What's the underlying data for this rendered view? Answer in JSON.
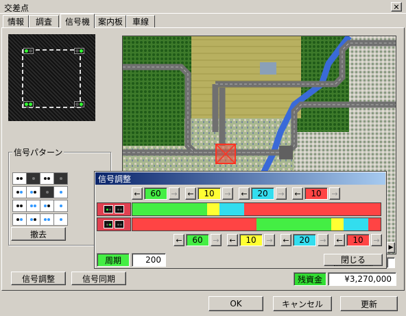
{
  "window": {
    "title": "交差点",
    "close_glyph": "✕"
  },
  "tabs": [
    {
      "label": "情報"
    },
    {
      "label": "調査"
    },
    {
      "label": "信号機",
      "active": true
    },
    {
      "label": "案内板"
    },
    {
      "label": "車線"
    }
  ],
  "pattern_group": {
    "label": "信号パターン",
    "remove_label": "撤去"
  },
  "buttons": {
    "signal_adjust": "信号調整",
    "signal_sync": "信号同期",
    "ok": "OK",
    "cancel": "キャンセル",
    "update": "更新"
  },
  "balance": {
    "label": "残資金",
    "value": "¥3,270,000",
    "label_color": "#33dd33"
  },
  "dialog": {
    "title": "信号調整",
    "left_arrow": "←",
    "right_arrow": "→",
    "top_phases": [
      {
        "value": "60",
        "color": "#44ee44"
      },
      {
        "value": "10",
        "color": "#ffff33"
      },
      {
        "value": "20",
        "color": "#33ddee"
      },
      {
        "value": "10",
        "color": "#ff4444"
      }
    ],
    "bottom_phases": [
      {
        "value": "60",
        "color": "#44ee44"
      },
      {
        "value": "10",
        "color": "#ffff33"
      },
      {
        "value": "20",
        "color": "#33ddee"
      },
      {
        "value": "10",
        "color": "#ff4444"
      }
    ],
    "timeline_row1": [
      {
        "phase": "green",
        "duration": 60,
        "color": "#44ee44"
      },
      {
        "phase": "yellow",
        "duration": 10,
        "color": "#ffff33"
      },
      {
        "phase": "cyan",
        "duration": 20,
        "color": "#33ddee"
      },
      {
        "phase": "red",
        "duration": 110,
        "color": "#ff4444"
      }
    ],
    "timeline_row2": [
      {
        "phase": "red",
        "duration": 100,
        "color": "#ff4444"
      },
      {
        "phase": "green",
        "duration": 60,
        "color": "#44ee44"
      },
      {
        "phase": "yellow",
        "duration": 10,
        "color": "#ffff33"
      },
      {
        "phase": "cyan",
        "duration": 20,
        "color": "#33ddee"
      },
      {
        "phase": "red",
        "duration": 10,
        "color": "#ff4444"
      }
    ],
    "cycle_label": "周期",
    "cycle_value": "200",
    "close_label": "閉じる"
  },
  "colors": {
    "window_bg": "#d4d0c8",
    "title_active": "#0a246a",
    "signal_icon_bg": "#e04050"
  }
}
